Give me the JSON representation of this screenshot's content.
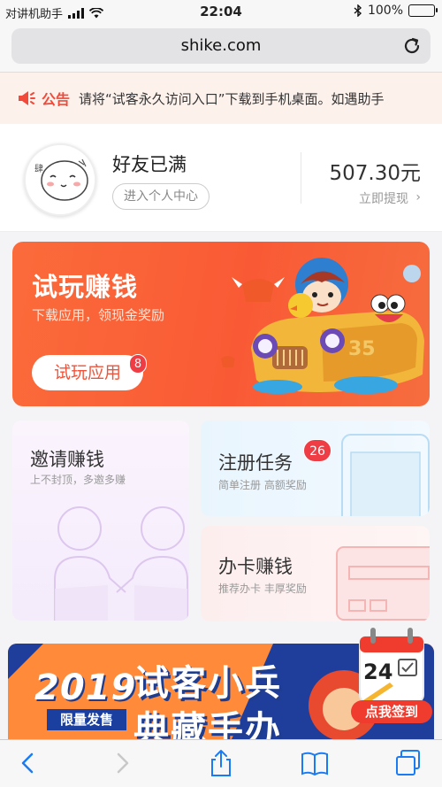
{
  "status_bar": {
    "carrier": "对讲机助手",
    "time": "22:04",
    "battery": "100%"
  },
  "browser": {
    "url": "shike.com"
  },
  "notice": {
    "label": "公告",
    "text": "请将“试客永久访问入口”下载到手机桌面。如遇助手"
  },
  "profile": {
    "name": "好友已满",
    "center_button": "进入个人中心",
    "balance": "507.30元",
    "withdraw": "立即提现"
  },
  "trial": {
    "title": "试玩赚钱",
    "subtitle": "下载应用，领现金奖励",
    "button": "试玩应用",
    "badge": "8",
    "car_plate": "35"
  },
  "cards": {
    "invite": {
      "title": "邀请赚钱",
      "subtitle": "上不封顶，多邀多赚"
    },
    "register": {
      "title": "注册任务",
      "subtitle": "简单注册 高额奖励",
      "badge": "26"
    },
    "card": {
      "title": "办卡赚钱",
      "subtitle": "推荐办卡 丰厚奖励"
    }
  },
  "promo": {
    "year": "2019",
    "tag": "限量发售",
    "title_line1": "试客小兵",
    "title_line2": "典藏手办"
  },
  "signin": {
    "day": "24",
    "label": "点我签到"
  },
  "colors": {
    "accent": "#f95a35",
    "badge": "#ee3d45",
    "notice_bg": "#fdf1ec"
  },
  "icons": {
    "reload": "reload-icon",
    "notice": "megaphone-icon",
    "back": "chevron-left-icon",
    "forward": "chevron-right-icon",
    "share": "share-icon",
    "bookmarks": "book-icon",
    "tabs": "tabs-icon"
  }
}
